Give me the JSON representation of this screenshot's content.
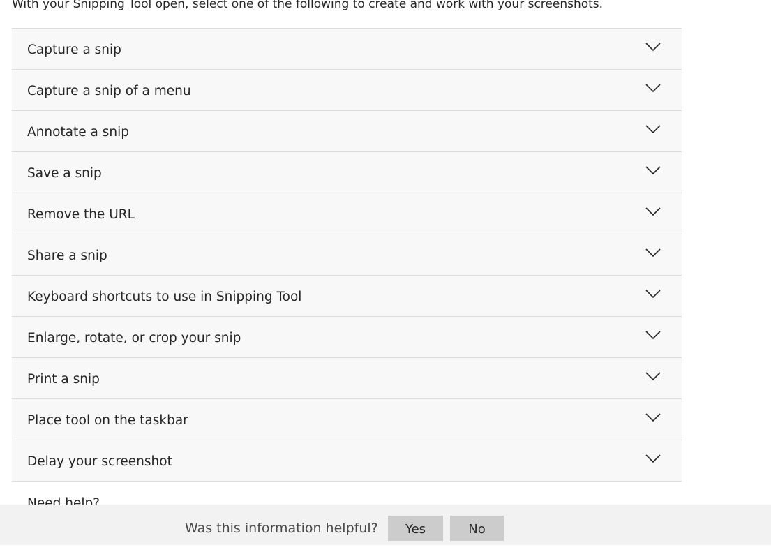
{
  "intro_text": "With your Snipping Tool open, select one of the following to create and work with your screenshots.",
  "accordion": {
    "items": [
      {
        "label": "Capture a snip"
      },
      {
        "label": "Capture a snip of a menu"
      },
      {
        "label": "Annotate a snip"
      },
      {
        "label": "Save a snip"
      },
      {
        "label": "Remove the URL"
      },
      {
        "label": "Share a snip"
      },
      {
        "label": "Keyboard shortcuts to use in Snipping Tool"
      },
      {
        "label": "Enlarge, rotate, or crop your snip"
      },
      {
        "label": "Print a snip"
      },
      {
        "label": "Place tool on the taskbar"
      },
      {
        "label": "Delay your screenshot"
      }
    ],
    "expand_icon": "chevron-down-icon"
  },
  "partially_hidden_text": "Need help?",
  "feedback": {
    "question": "Was this information helpful?",
    "yes_label": "Yes",
    "no_label": "No"
  },
  "colors": {
    "item_background": "#f8f8f8",
    "divider": "#dcdcdc",
    "feedback_background": "#f2f2f2",
    "button_background": "#cccccc",
    "text": "#262626"
  }
}
